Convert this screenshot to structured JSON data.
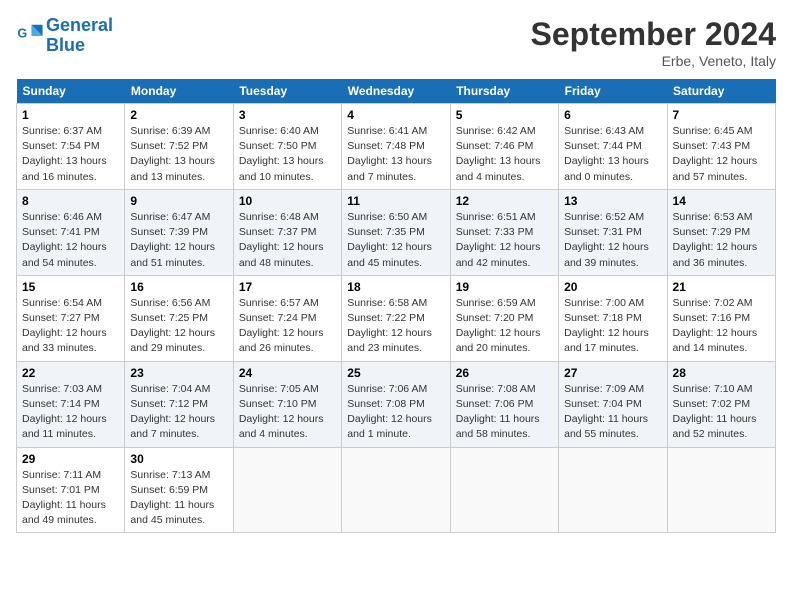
{
  "header": {
    "logo_line1": "General",
    "logo_line2": "Blue",
    "month": "September 2024",
    "location": "Erbe, Veneto, Italy"
  },
  "days_of_week": [
    "Sunday",
    "Monday",
    "Tuesday",
    "Wednesday",
    "Thursday",
    "Friday",
    "Saturday"
  ],
  "weeks": [
    [
      {
        "day": "1",
        "info": "Sunrise: 6:37 AM\nSunset: 7:54 PM\nDaylight: 13 hours\nand 16 minutes."
      },
      {
        "day": "2",
        "info": "Sunrise: 6:39 AM\nSunset: 7:52 PM\nDaylight: 13 hours\nand 13 minutes."
      },
      {
        "day": "3",
        "info": "Sunrise: 6:40 AM\nSunset: 7:50 PM\nDaylight: 13 hours\nand 10 minutes."
      },
      {
        "day": "4",
        "info": "Sunrise: 6:41 AM\nSunset: 7:48 PM\nDaylight: 13 hours\nand 7 minutes."
      },
      {
        "day": "5",
        "info": "Sunrise: 6:42 AM\nSunset: 7:46 PM\nDaylight: 13 hours\nand 4 minutes."
      },
      {
        "day": "6",
        "info": "Sunrise: 6:43 AM\nSunset: 7:44 PM\nDaylight: 13 hours\nand 0 minutes."
      },
      {
        "day": "7",
        "info": "Sunrise: 6:45 AM\nSunset: 7:43 PM\nDaylight: 12 hours\nand 57 minutes."
      }
    ],
    [
      {
        "day": "8",
        "info": "Sunrise: 6:46 AM\nSunset: 7:41 PM\nDaylight: 12 hours\nand 54 minutes."
      },
      {
        "day": "9",
        "info": "Sunrise: 6:47 AM\nSunset: 7:39 PM\nDaylight: 12 hours\nand 51 minutes."
      },
      {
        "day": "10",
        "info": "Sunrise: 6:48 AM\nSunset: 7:37 PM\nDaylight: 12 hours\nand 48 minutes."
      },
      {
        "day": "11",
        "info": "Sunrise: 6:50 AM\nSunset: 7:35 PM\nDaylight: 12 hours\nand 45 minutes."
      },
      {
        "day": "12",
        "info": "Sunrise: 6:51 AM\nSunset: 7:33 PM\nDaylight: 12 hours\nand 42 minutes."
      },
      {
        "day": "13",
        "info": "Sunrise: 6:52 AM\nSunset: 7:31 PM\nDaylight: 12 hours\nand 39 minutes."
      },
      {
        "day": "14",
        "info": "Sunrise: 6:53 AM\nSunset: 7:29 PM\nDaylight: 12 hours\nand 36 minutes."
      }
    ],
    [
      {
        "day": "15",
        "info": "Sunrise: 6:54 AM\nSunset: 7:27 PM\nDaylight: 12 hours\nand 33 minutes."
      },
      {
        "day": "16",
        "info": "Sunrise: 6:56 AM\nSunset: 7:25 PM\nDaylight: 12 hours\nand 29 minutes."
      },
      {
        "day": "17",
        "info": "Sunrise: 6:57 AM\nSunset: 7:24 PM\nDaylight: 12 hours\nand 26 minutes."
      },
      {
        "day": "18",
        "info": "Sunrise: 6:58 AM\nSunset: 7:22 PM\nDaylight: 12 hours\nand 23 minutes."
      },
      {
        "day": "19",
        "info": "Sunrise: 6:59 AM\nSunset: 7:20 PM\nDaylight: 12 hours\nand 20 minutes."
      },
      {
        "day": "20",
        "info": "Sunrise: 7:00 AM\nSunset: 7:18 PM\nDaylight: 12 hours\nand 17 minutes."
      },
      {
        "day": "21",
        "info": "Sunrise: 7:02 AM\nSunset: 7:16 PM\nDaylight: 12 hours\nand 14 minutes."
      }
    ],
    [
      {
        "day": "22",
        "info": "Sunrise: 7:03 AM\nSunset: 7:14 PM\nDaylight: 12 hours\nand 11 minutes."
      },
      {
        "day": "23",
        "info": "Sunrise: 7:04 AM\nSunset: 7:12 PM\nDaylight: 12 hours\nand 7 minutes."
      },
      {
        "day": "24",
        "info": "Sunrise: 7:05 AM\nSunset: 7:10 PM\nDaylight: 12 hours\nand 4 minutes."
      },
      {
        "day": "25",
        "info": "Sunrise: 7:06 AM\nSunset: 7:08 PM\nDaylight: 12 hours\nand 1 minute."
      },
      {
        "day": "26",
        "info": "Sunrise: 7:08 AM\nSunset: 7:06 PM\nDaylight: 11 hours\nand 58 minutes."
      },
      {
        "day": "27",
        "info": "Sunrise: 7:09 AM\nSunset: 7:04 PM\nDaylight: 11 hours\nand 55 minutes."
      },
      {
        "day": "28",
        "info": "Sunrise: 7:10 AM\nSunset: 7:02 PM\nDaylight: 11 hours\nand 52 minutes."
      }
    ],
    [
      {
        "day": "29",
        "info": "Sunrise: 7:11 AM\nSunset: 7:01 PM\nDaylight: 11 hours\nand 49 minutes."
      },
      {
        "day": "30",
        "info": "Sunrise: 7:13 AM\nSunset: 6:59 PM\nDaylight: 11 hours\nand 45 minutes."
      },
      {
        "day": "",
        "info": ""
      },
      {
        "day": "",
        "info": ""
      },
      {
        "day": "",
        "info": ""
      },
      {
        "day": "",
        "info": ""
      },
      {
        "day": "",
        "info": ""
      }
    ]
  ]
}
